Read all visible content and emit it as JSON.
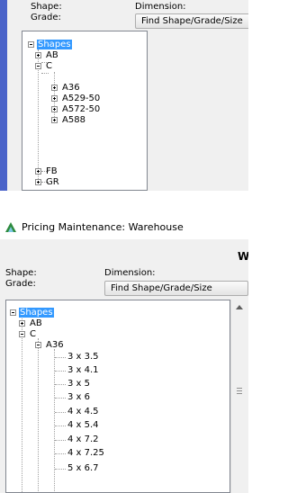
{
  "top_crop": {
    "shape_label": "Shape:",
    "grade_label": "Grade:",
    "dimension_label": "Dimension:",
    "find_button": "Find Shape/Grade/Size",
    "tree": {
      "root": "Shapes",
      "nodes": [
        {
          "label": "AB"
        },
        {
          "label": "C",
          "children": [
            "A36",
            "A529-50",
            "A572-50",
            "A588"
          ]
        },
        {
          "label": "FB"
        },
        {
          "label": "GR"
        }
      ]
    }
  },
  "window": {
    "title": "Pricing Maintenance: Warehouse",
    "header_letter": "W",
    "shape_label": "Shape:",
    "grade_label": "Grade:",
    "dimension_label": "Dimension:",
    "find_button": "Find Shape/Grade/Size",
    "tree": {
      "root": "Shapes",
      "nodes": [
        {
          "label": "AB"
        },
        {
          "label": "C",
          "children": [
            {
              "label": "A36",
              "children": [
                "3 x 3.5",
                "3 x 4.1",
                "3 x 5",
                "3 x 6",
                "4 x 4.5",
                "4 x 5.4",
                "4 x 7.2",
                "4 x 7.25",
                "5 x 6.7"
              ]
            }
          ]
        }
      ]
    },
    "accent_color": "#3399ff"
  }
}
